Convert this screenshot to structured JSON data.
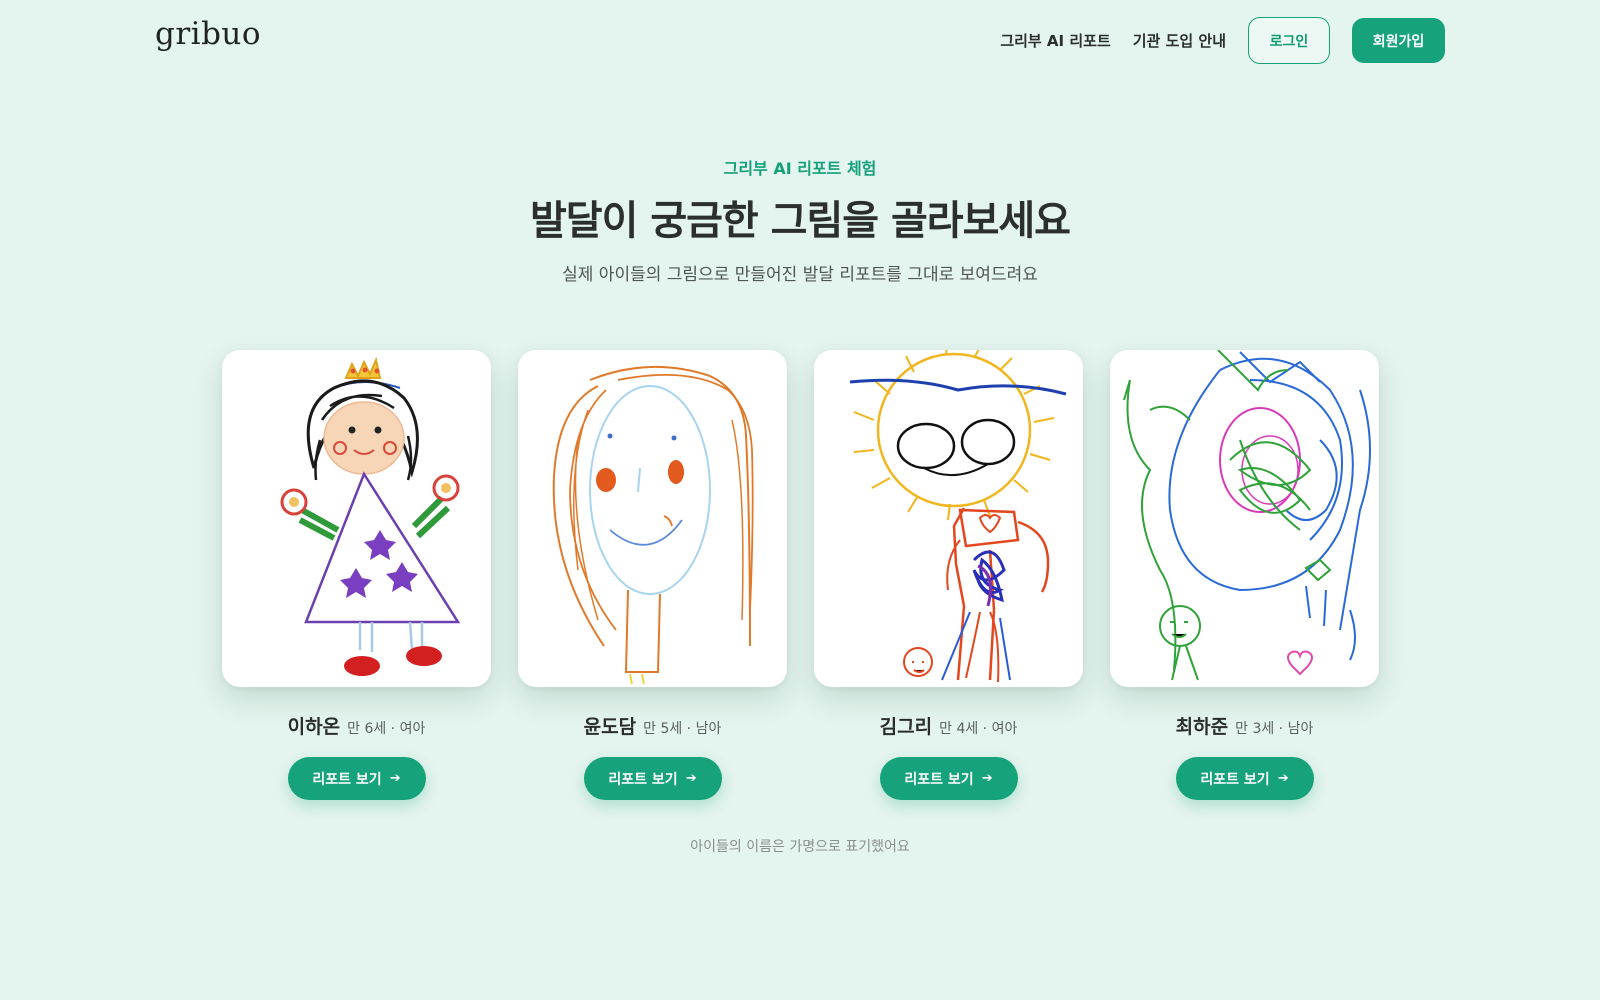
{
  "header": {
    "logo": "gribuo",
    "nav": [
      "그리부 AI 리포트",
      "기관 도입 안내"
    ],
    "login_label": "로그인",
    "signup_label": "회원가입"
  },
  "hero": {
    "eyebrow": "그리부 AI 리포트 체험",
    "title": "발달이 궁금한 그림을 골라보세요",
    "subtitle": "실제 아이들의 그림으로 만들어진 발달 리포트를 그대로 보여드려요"
  },
  "cards": [
    {
      "name": "이하온",
      "info": "만 6세 · 여아",
      "button": "리포트 보기",
      "icon": "arrow-right-icon"
    },
    {
      "name": "윤도담",
      "info": "만 5세 · 남아",
      "button": "리포트 보기",
      "icon": "arrow-right-icon"
    },
    {
      "name": "김그리",
      "info": "만 4세 · 여아",
      "button": "리포트 보기",
      "icon": "arrow-right-icon"
    },
    {
      "name": "최하준",
      "info": "만 3세 · 남아",
      "button": "리포트 보기",
      "icon": "arrow-right-icon"
    }
  ],
  "footnote": "아이들의 이름은 가명으로 표기했어요",
  "colors": {
    "background": "#e4f4ee",
    "accent": "#16a37b",
    "text": "#2a2e2c"
  }
}
